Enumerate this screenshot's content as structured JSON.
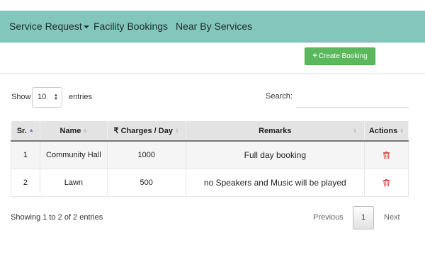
{
  "nav": {
    "items": [
      {
        "label": "Service Request",
        "has_dropdown": true
      },
      {
        "label": "Facility Bookings",
        "has_dropdown": false
      },
      {
        "label": "Near By Services",
        "has_dropdown": false
      }
    ],
    "bar_color": "#83c6bb"
  },
  "toolbar": {
    "create_label": "Create Booking",
    "create_icon": "plus-icon",
    "button_color": "#5cb85c"
  },
  "length_control": {
    "show_label": "Show",
    "selected": "10",
    "entries_label": "entries"
  },
  "search": {
    "label": "Search:",
    "value": "",
    "placeholder": ""
  },
  "table": {
    "columns": [
      {
        "label": "Sr.",
        "sort": "asc"
      },
      {
        "label": "Name",
        "sort": "none"
      },
      {
        "label": "Charges / Day",
        "prefix_icon": "rupee-icon",
        "prefix": "₹",
        "sort": "none"
      },
      {
        "label": "Remarks",
        "sort": "none"
      },
      {
        "label": "Actions",
        "sort": "none"
      }
    ],
    "rows": [
      {
        "sr": "1",
        "name": "Community Hall",
        "charges": "1000",
        "remarks": "Full day booking",
        "action_icon": "trash-icon"
      },
      {
        "sr": "2",
        "name": "Lawn",
        "charges": "500",
        "remarks": "no Speakers and Music will be played",
        "action_icon": "trash-icon"
      }
    ],
    "delete_color": "#d9534f"
  },
  "footer": {
    "info": "Showing 1 to 2 of 2 entries",
    "prev_label": "Previous",
    "current_page": "1",
    "next_label": "Next"
  }
}
